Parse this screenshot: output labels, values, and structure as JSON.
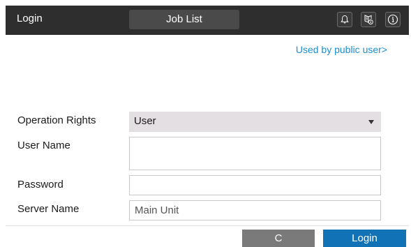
{
  "header": {
    "title": "Login",
    "tab_label": "Job List",
    "icons": [
      "bell-icon",
      "device-info-icon",
      "info-icon"
    ]
  },
  "link": {
    "public_user": "Used by public user>"
  },
  "form": {
    "operation_rights_label": "Operation Rights",
    "operation_rights_value": "User",
    "user_name_label": "User Name",
    "user_name_value": "",
    "password_label": "Password",
    "password_value": "",
    "server_name_label": "Server Name",
    "server_name_value": "Main Unit"
  },
  "footer": {
    "clear_label": "C",
    "login_label": "Login"
  },
  "colors": {
    "header_bg": "#2e2e2e",
    "link": "#1a8fd6",
    "login_button": "#1173b6",
    "clear_button": "#7a7a7a",
    "select_bg": "#e3dfe3"
  }
}
